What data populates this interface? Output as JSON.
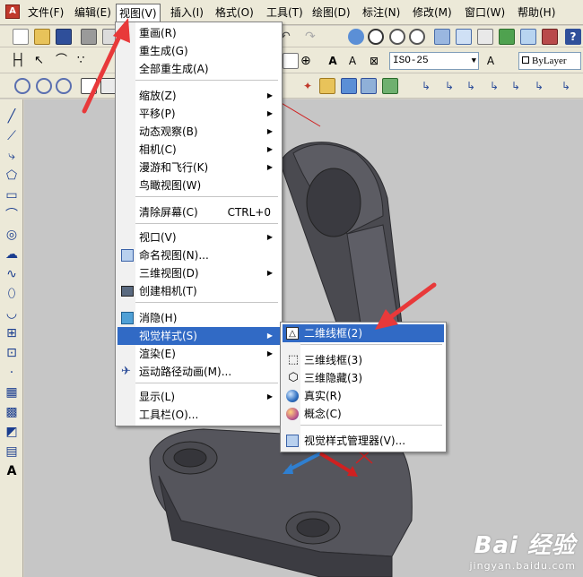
{
  "menubar": {
    "items": [
      "文件(F)",
      "编辑(E)",
      "视图(V)",
      "插入(I)",
      "格式(O)",
      "工具(T)",
      "绘图(D)",
      "标注(N)",
      "修改(M)",
      "窗口(W)",
      "帮助(H)"
    ]
  },
  "toolbar": {
    "dimstyle": "ISO-25",
    "layer_color": "ByLayer"
  },
  "view_menu": {
    "items": [
      {
        "label": "重画(R)"
      },
      {
        "label": "重生成(G)"
      },
      {
        "label": "全部重生成(A)"
      },
      {
        "label": "缩放(Z)"
      },
      {
        "label": "平移(P)"
      },
      {
        "label": "动态观察(B)"
      },
      {
        "label": "相机(C)"
      },
      {
        "label": "漫游和飞行(K)"
      },
      {
        "label": "鸟瞰视图(W)"
      },
      {
        "label": "清除屏幕(C)",
        "shortcut": "CTRL+0"
      },
      {
        "label": "视口(V)"
      },
      {
        "label": "命名视图(N)..."
      },
      {
        "label": "三维视图(D)"
      },
      {
        "label": "创建相机(T)"
      },
      {
        "label": "消隐(H)"
      },
      {
        "label": "视觉样式(S)"
      },
      {
        "label": "渲染(E)"
      },
      {
        "label": "运动路径动画(M)..."
      },
      {
        "label": "显示(L)"
      },
      {
        "label": "工具栏(O)..."
      }
    ]
  },
  "visual_styles_menu": {
    "items": [
      {
        "label": "二维线框(2)"
      },
      {
        "label": "三维线框(3)"
      },
      {
        "label": "三维隐藏(3)"
      },
      {
        "label": "真实(R)"
      },
      {
        "label": "概念(C)"
      },
      {
        "label": "视觉样式管理器(V)..."
      }
    ]
  },
  "watermark": {
    "brand": "Bai 经验",
    "url": "jingyan.baidu.com"
  },
  "colors": {
    "highlight": "#316ac5",
    "arrow": "#e8393a",
    "model": "#55555c"
  }
}
